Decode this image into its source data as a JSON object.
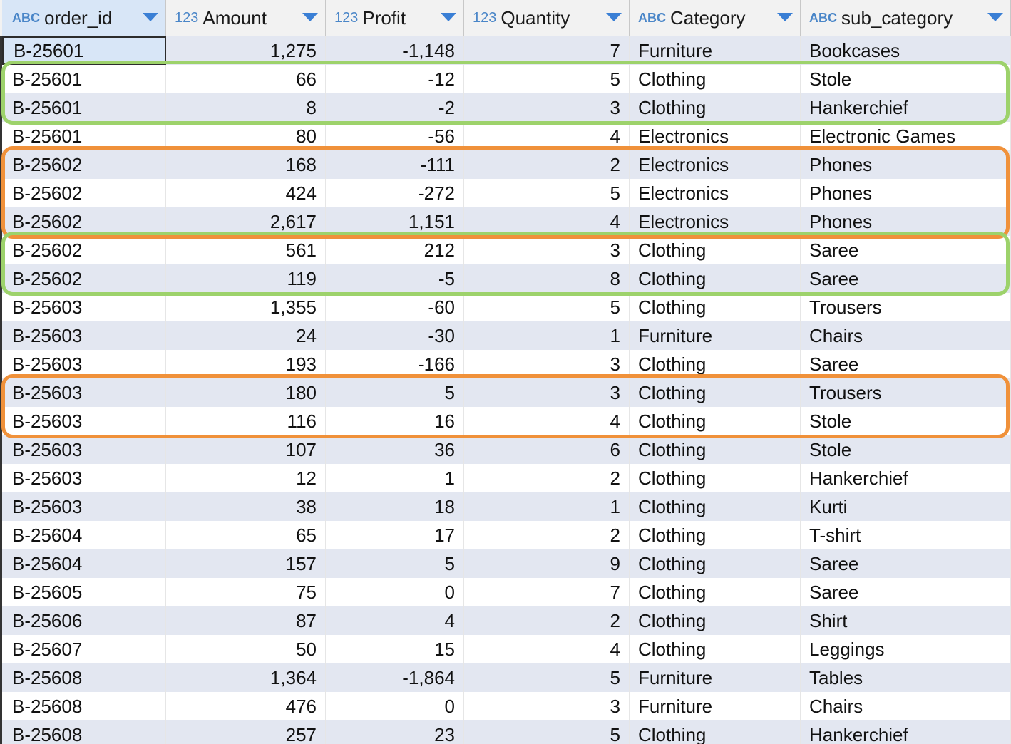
{
  "columns": [
    {
      "type": "ABC",
      "name": "order_id"
    },
    {
      "type": "123",
      "name": "Amount"
    },
    {
      "type": "123",
      "name": "Profit"
    },
    {
      "type": "123",
      "name": "Quantity"
    },
    {
      "type": "ABC",
      "name": "Category"
    },
    {
      "type": "ABC",
      "name": "sub_category"
    }
  ],
  "rows": [
    [
      "B-25601",
      "1,275",
      "-1,148",
      "7",
      "Furniture",
      "Bookcases"
    ],
    [
      "B-25601",
      "66",
      "-12",
      "5",
      "Clothing",
      "Stole"
    ],
    [
      "B-25601",
      "8",
      "-2",
      "3",
      "Clothing",
      "Hankerchief"
    ],
    [
      "B-25601",
      "80",
      "-56",
      "4",
      "Electronics",
      "Electronic Games"
    ],
    [
      "B-25602",
      "168",
      "-111",
      "2",
      "Electronics",
      "Phones"
    ],
    [
      "B-25602",
      "424",
      "-272",
      "5",
      "Electronics",
      "Phones"
    ],
    [
      "B-25602",
      "2,617",
      "1,151",
      "4",
      "Electronics",
      "Phones"
    ],
    [
      "B-25602",
      "561",
      "212",
      "3",
      "Clothing",
      "Saree"
    ],
    [
      "B-25602",
      "119",
      "-5",
      "8",
      "Clothing",
      "Saree"
    ],
    [
      "B-25603",
      "1,355",
      "-60",
      "5",
      "Clothing",
      "Trousers"
    ],
    [
      "B-25603",
      "24",
      "-30",
      "1",
      "Furniture",
      "Chairs"
    ],
    [
      "B-25603",
      "193",
      "-166",
      "3",
      "Clothing",
      "Saree"
    ],
    [
      "B-25603",
      "180",
      "5",
      "3",
      "Clothing",
      "Trousers"
    ],
    [
      "B-25603",
      "116",
      "16",
      "4",
      "Clothing",
      "Stole"
    ],
    [
      "B-25603",
      "107",
      "36",
      "6",
      "Clothing",
      "Stole"
    ],
    [
      "B-25603",
      "12",
      "1",
      "2",
      "Clothing",
      "Hankerchief"
    ],
    [
      "B-25603",
      "38",
      "18",
      "1",
      "Clothing",
      "Kurti"
    ],
    [
      "B-25604",
      "65",
      "17",
      "2",
      "Clothing",
      "T-shirt"
    ],
    [
      "B-25604",
      "157",
      "5",
      "9",
      "Clothing",
      "Saree"
    ],
    [
      "B-25605",
      "75",
      "0",
      "7",
      "Clothing",
      "Saree"
    ],
    [
      "B-25606",
      "87",
      "4",
      "2",
      "Clothing",
      "Shirt"
    ],
    [
      "B-25607",
      "50",
      "15",
      "4",
      "Clothing",
      "Leggings"
    ],
    [
      "B-25608",
      "1,364",
      "-1,864",
      "5",
      "Furniture",
      "Tables"
    ],
    [
      "B-25608",
      "476",
      "0",
      "3",
      "Furniture",
      "Chairs"
    ],
    [
      "B-25608",
      "257",
      "23",
      "5",
      "Clothing",
      "Hankerchief"
    ]
  ],
  "highlights": [
    {
      "color": "green",
      "rows": [
        1,
        2
      ]
    },
    {
      "color": "orange",
      "rows": [
        4,
        5,
        6
      ]
    },
    {
      "color": "green",
      "rows": [
        7,
        8
      ]
    },
    {
      "color": "orange",
      "rows": [
        12,
        13
      ]
    }
  ],
  "colors": {
    "highlight_green": "#9dd26b",
    "highlight_orange": "#f0913a",
    "row_alt": "#e3e7f1",
    "type_badge": "#4a86c8",
    "sort_arrow": "#3a7fd5"
  },
  "icons": {
    "text_type": "abc-type-icon",
    "number_type": "123-type-icon",
    "sort": "sort-dropdown-icon"
  }
}
